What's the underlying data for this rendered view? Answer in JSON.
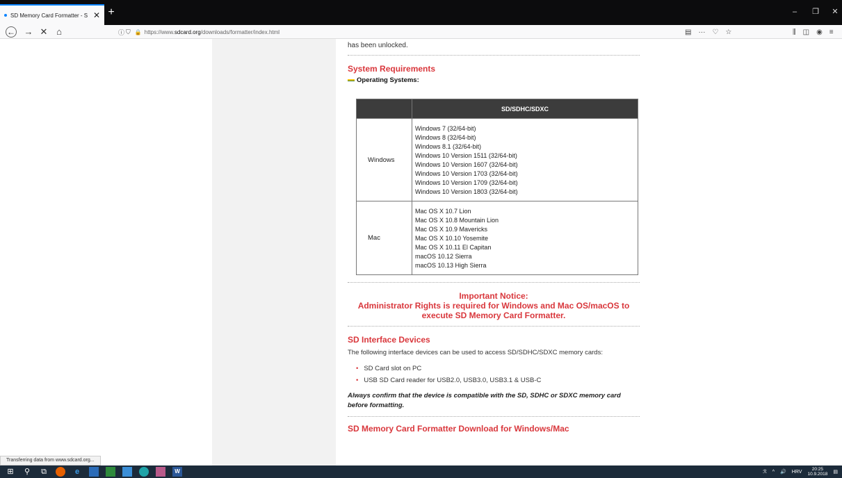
{
  "tab": {
    "title": "SD Memory Card Formatter - S",
    "close": "✕"
  },
  "newtab": "+",
  "window_controls": {
    "minimize": "–",
    "restore": "❐",
    "close": "✕"
  },
  "nav": {
    "back": "←",
    "forward": "→",
    "stop": "✕",
    "home": "⌂"
  },
  "url": {
    "prefix": "https://www.",
    "host": "sdcard.org",
    "path": "/downloads/formatter/index.html"
  },
  "url_actions": {
    "reader": "▤",
    "more": "···",
    "pocket": "♡",
    "bookmark": "☆"
  },
  "tools": {
    "library": "⫼",
    "sidebar": "◫",
    "account": "◉",
    "menu": "≡"
  },
  "content": {
    "intro_tail": "has been unlocked.",
    "sysreq_heading": "System Requirements",
    "os_label": "Operating Systems:",
    "table": {
      "header_blank": "",
      "header": "SD/SDHC/SDXC",
      "rows": [
        {
          "os": "Windows",
          "versions": [
            "Windows 7 (32/64-bit)",
            "Windows 8 (32/64-bit)",
            "Windows 8.1 (32/64-bit)",
            "Windows 10 Version 1511 (32/64-bit)",
            "Windows 10 Version 1607 (32/64-bit)",
            "Windows 10 Version 1703 (32/64-bit)",
            "Windows 10 Version 1709 (32/64-bit)",
            "Windows 10 Version 1803 (32/64-bit)"
          ]
        },
        {
          "os": "Mac",
          "versions": [
            "Mac OS X 10.7 Lion",
            "Mac OS X 10.8 Mountain Lion",
            "Mac OS X 10.9 Mavericks",
            "Mac OS X 10.10 Yosemite",
            "Mac OS X 10.11 El Capitan",
            "macOS 10.12 Sierra",
            "macOS 10.13 High Sierra"
          ]
        }
      ]
    },
    "notice_title": "Important Notice:",
    "notice_line1": "Administrator Rights is required for Windows and Mac OS/macOS to",
    "notice_line2": "execute SD Memory Card Formatter.",
    "interface_heading": "SD Interface Devices",
    "interface_text": "The following interface devices can be used to access SD/SDHC/SDXC memory cards:",
    "bullets": [
      "SD Card slot on PC",
      "USB SD Card reader for USB2.0, USB3.0, USB3.1 & USB-C"
    ],
    "note": "Always confirm that the device is compatible with the SD, SDHC or SDXC memory card before formatting.",
    "download_heading": "SD Memory Card Formatter Download for Windows/Mac"
  },
  "status": "Transferring data from www.sdcard.org...",
  "taskbar": {
    "start": "⊞",
    "search": "⚲",
    "taskview": "⧉",
    "tray_lang": "HRV",
    "tray_volume": "🔊",
    "tray_chevron": "^",
    "tray_people": "ℛ",
    "time": "20:25",
    "date": "10.9.2018"
  }
}
